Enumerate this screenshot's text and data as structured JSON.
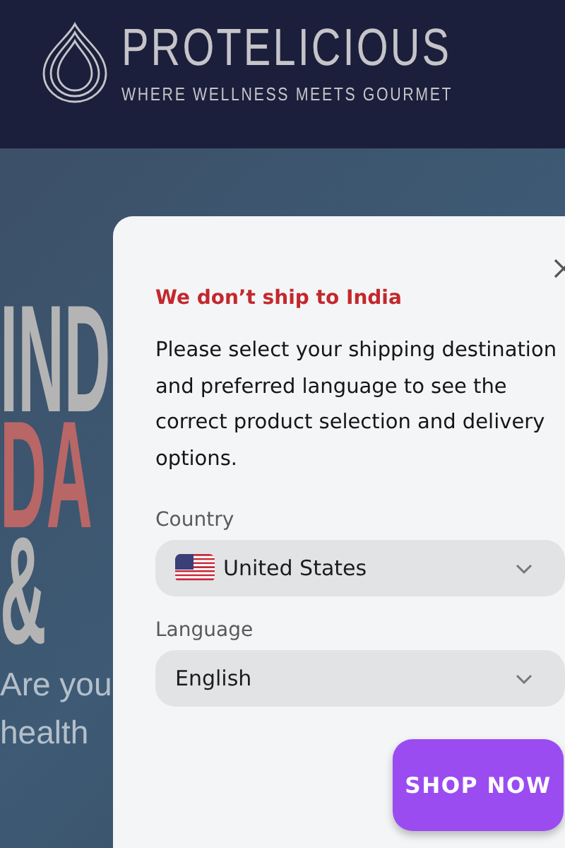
{
  "header": {
    "brand": "PROTELICIOUS",
    "tagline": "WHERE WELLNESS MEETS GOURMET"
  },
  "hero": {
    "lines": [
      {
        "text": "IND",
        "accent": false
      },
      {
        "text": "DA",
        "accent": true
      },
      {
        "text": "&",
        "accent": false
      }
    ],
    "subtitle": [
      "Are you",
      "health"
    ]
  },
  "modal": {
    "title": "We don’t ship to India",
    "message": "Please select your shipping destination and preferred language to see the correct product selection and delivery options.",
    "fields": [
      {
        "label": "Country",
        "value": "United States",
        "flag": true
      },
      {
        "label": "Language",
        "value": "English",
        "flag": false
      }
    ]
  },
  "cta": {
    "label": "SHOP NOW"
  }
}
